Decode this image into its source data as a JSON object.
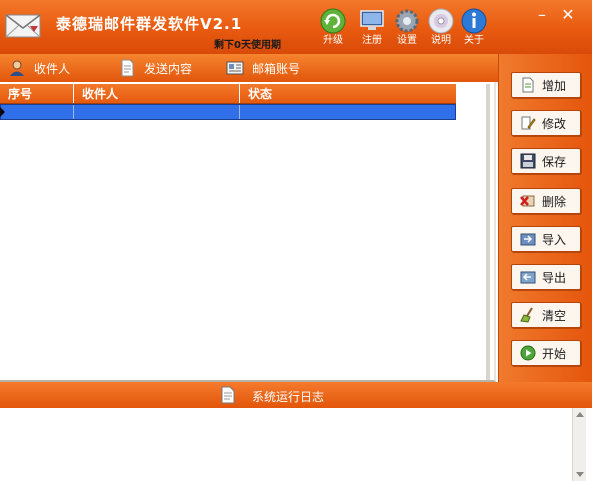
{
  "app": {
    "title": "泰德瑞邮件群发软件V2.1",
    "remaining": "剩下0天使用期"
  },
  "toolbar": {
    "upgrade": "升级",
    "register": "注册",
    "settings": "设置",
    "help": "说明",
    "about": "关于",
    "minimize": "–",
    "close": "✕"
  },
  "tabs": {
    "recipients": "收件人",
    "content": "发送内容",
    "accounts": "邮箱账号"
  },
  "grid": {
    "columns": [
      "序号",
      "收件人",
      "状态"
    ],
    "rows": [
      [
        "",
        "",
        ""
      ]
    ]
  },
  "actions": {
    "add": "增加",
    "edit": "修改",
    "save": "保存",
    "delete": "删除",
    "import": "导入",
    "export": "导出",
    "clear": "清空",
    "start": "开始"
  },
  "log": {
    "title": "系统运行日志"
  },
  "colors": {
    "accent": "#e85a10",
    "selected_row": "#2f6fe8"
  }
}
